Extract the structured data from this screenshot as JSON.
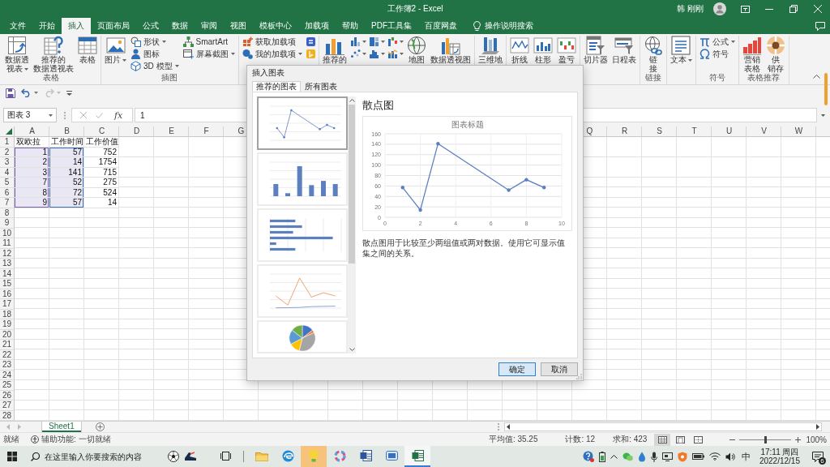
{
  "window": {
    "title": "工作簿2 - Excel",
    "user": "韩 刚刚"
  },
  "ribbon_tabs": [
    {
      "label": "文件",
      "selected": false
    },
    {
      "label": "开始",
      "selected": false
    },
    {
      "label": "插入",
      "selected": true
    },
    {
      "label": "页面布局",
      "selected": false
    },
    {
      "label": "公式",
      "selected": false
    },
    {
      "label": "数据",
      "selected": false
    },
    {
      "label": "审阅",
      "selected": false
    },
    {
      "label": "视图",
      "selected": false
    },
    {
      "label": "模板中心",
      "selected": false
    },
    {
      "label": "加载项",
      "selected": false
    },
    {
      "label": "帮助",
      "selected": false
    },
    {
      "label": "PDF工具集",
      "selected": false
    },
    {
      "label": "百度网盘",
      "selected": false
    }
  ],
  "tell_me": {
    "label": "操作说明搜索"
  },
  "ribbon_groups": [
    {
      "label": "表格",
      "items": [
        {
          "kind": "large",
          "lines": [
            "数据透",
            "视表"
          ],
          "menu": true
        },
        {
          "kind": "large",
          "lines": [
            "推荐的",
            "数据透视表"
          ],
          "menu": false
        },
        {
          "kind": "large",
          "lines": [
            "表格"
          ],
          "menu": false
        }
      ]
    },
    {
      "label": "插图",
      "items": [
        {
          "kind": "large",
          "lines": [
            "图片"
          ],
          "menu": true
        },
        {
          "kind": "stack",
          "items": [
            {
              "label": "形状",
              "menu": true
            },
            {
              "label": "图标",
              "menu": false
            },
            {
              "label": "3D 模型",
              "menu": true
            }
          ]
        },
        {
          "kind": "stack",
          "items": [
            {
              "label": "SmartArt",
              "menu": false
            },
            {
              "label": "屏幕截图",
              "menu": true
            }
          ]
        }
      ]
    },
    {
      "items": [
        {
          "kind": "stack",
          "items": [
            {
              "label": "获取加载项",
              "menu": false
            },
            {
              "label": "我的加载项",
              "menu": true
            }
          ]
        },
        {
          "kind": "icons",
          "items": [
            {
              "menu": false
            },
            {
              "menu": false
            }
          ]
        }
      ]
    },
    {
      "items": [
        {
          "kind": "large",
          "lines": [
            "推荐的"
          ],
          "menu": false
        },
        {
          "kind": "icons",
          "items": [
            {
              "menu": true
            },
            {
              "menu": true
            },
            {
              "menu": true
            },
            {
              "menu": true
            },
            {
              "menu": true
            },
            {
              "menu": true
            }
          ]
        },
        {
          "kind": "large",
          "lines": [
            "地图"
          ],
          "menu": false
        },
        {
          "kind": "large",
          "lines": [
            "数据透视图"
          ],
          "menu": false
        }
      ]
    },
    {
      "items": [
        {
          "kind": "large",
          "lines": [
            "三维地"
          ],
          "menu": false
        }
      ]
    },
    {
      "items": [
        {
          "kind": "large",
          "lines": [
            "折线"
          ],
          "menu": false
        },
        {
          "kind": "large",
          "lines": [
            "柱形"
          ],
          "menu": false
        },
        {
          "kind": "large",
          "lines": [
            "盈亏"
          ],
          "menu": false
        }
      ]
    },
    {
      "items": [
        {
          "kind": "large",
          "lines": [
            "切片器"
          ],
          "menu": false
        },
        {
          "kind": "large",
          "lines": [
            "日程表"
          ],
          "menu": false
        }
      ]
    },
    {
      "label": "链接",
      "items": [
        {
          "kind": "large",
          "lines": [
            "链",
            "接"
          ],
          "menu": false
        }
      ]
    },
    {
      "items": [
        {
          "kind": "large",
          "lines": [
            "文本"
          ],
          "menu": true
        }
      ]
    },
    {
      "label": "符号",
      "items": [
        {
          "kind": "stack",
          "items": [
            {
              "label": "公式",
              "menu": true
            },
            {
              "label": "符号",
              "menu": false
            }
          ]
        }
      ]
    },
    {
      "label": "表格推荐",
      "items": [
        {
          "kind": "large",
          "lines": [
            "营销",
            "表格"
          ],
          "menu": false
        },
        {
          "kind": "large",
          "lines": [
            "供",
            "销存"
          ],
          "menu": false
        }
      ]
    }
  ],
  "quick_access": [
    {
      "menu": false,
      "disabled": false
    },
    {
      "menu": true,
      "disabled": false
    },
    {
      "menu": true,
      "disabled": true
    },
    {
      "menu": false,
      "disabled": false
    }
  ],
  "formula_bar": {
    "name_box": "图表 3",
    "insert_function": "fx",
    "value": "1"
  },
  "sheet": {
    "columns_left": [
      "A",
      "B",
      "C",
      "D",
      "E",
      "F",
      "G"
    ],
    "columns_right": [
      "Q",
      "R",
      "S",
      "T",
      "U",
      "V",
      "W"
    ],
    "rows": [
      {
        "header": "1",
        "kind": "labels",
        "cells": [
          {
            "value": "双欧拉",
            "selected": false
          },
          {
            "value": "工作时间",
            "selected": false
          },
          {
            "value": "工作价值",
            "selected": false
          }
        ]
      },
      {
        "header": "2",
        "kind": "values",
        "cells": [
          {
            "value": "1",
            "selected": true
          },
          {
            "value": "57",
            "selected": true
          },
          {
            "value": "752",
            "selected": false
          }
        ]
      },
      {
        "header": "3",
        "kind": "values",
        "cells": [
          {
            "value": "2",
            "selected": true
          },
          {
            "value": "14",
            "selected": true
          },
          {
            "value": "1754",
            "selected": false
          }
        ]
      },
      {
        "header": "4",
        "kind": "values",
        "cells": [
          {
            "value": "3",
            "selected": true
          },
          {
            "value": "141",
            "selected": true
          },
          {
            "value": "715",
            "selected": false
          }
        ]
      },
      {
        "header": "5",
        "kind": "values",
        "cells": [
          {
            "value": "7",
            "selected": true
          },
          {
            "value": "52",
            "selected": true
          },
          {
            "value": "275",
            "selected": false
          }
        ]
      },
      {
        "header": "6",
        "kind": "values",
        "cells": [
          {
            "value": "8",
            "selected": true
          },
          {
            "value": "72",
            "selected": true
          },
          {
            "value": "524",
            "selected": false
          }
        ]
      },
      {
        "header": "7",
        "kind": "values",
        "cells": [
          {
            "value": "9",
            "selected": true
          },
          {
            "value": "57",
            "selected": true
          },
          {
            "value": "14",
            "selected": false
          }
        ]
      },
      {
        "header": "8",
        "kind": "empty"
      },
      {
        "header": "9",
        "kind": "empty"
      },
      {
        "header": "10",
        "kind": "empty"
      },
      {
        "header": "11",
        "kind": "empty"
      },
      {
        "header": "12",
        "kind": "empty"
      },
      {
        "header": "13",
        "kind": "empty"
      },
      {
        "header": "14",
        "kind": "empty"
      },
      {
        "header": "15",
        "kind": "empty"
      },
      {
        "header": "16",
        "kind": "empty"
      },
      {
        "header": "17",
        "kind": "empty"
      },
      {
        "header": "18",
        "kind": "empty"
      },
      {
        "header": "19",
        "kind": "empty"
      },
      {
        "header": "20",
        "kind": "empty"
      },
      {
        "header": "21",
        "kind": "empty"
      },
      {
        "header": "22",
        "kind": "empty"
      },
      {
        "header": "23",
        "kind": "empty"
      },
      {
        "header": "24",
        "kind": "empty"
      },
      {
        "header": "25",
        "kind": "empty"
      },
      {
        "header": "26",
        "kind": "empty"
      },
      {
        "header": "27",
        "kind": "empty"
      },
      {
        "header": "28",
        "kind": "empty"
      }
    ]
  },
  "sheet_tabs": [
    {
      "label": "Sheet1",
      "selected": true
    }
  ],
  "status_bar": {
    "mode": "就绪",
    "accessibility": "辅助功能: 一切就绪",
    "average": "平均值: 35.25",
    "count": "计数: 12",
    "sum": "求和: 423",
    "views": [
      {
        "selected": true
      },
      {
        "selected": false
      },
      {
        "selected": false
      }
    ],
    "zoom": {
      "level": 0.5,
      "reading": "100%"
    }
  },
  "taskbar": {
    "search": {
      "placeholder": "在这里输入你要搜索的内容"
    },
    "apps": [
      {
        "selected": false,
        "flashing": false
      },
      {
        "selected": false,
        "flashing": false
      },
      {
        "selected": false,
        "flashing": true
      },
      {
        "selected": false,
        "flashing": false
      },
      {
        "selected": false,
        "flashing": false
      },
      {
        "selected": false,
        "flashing": false
      },
      {
        "selected": true,
        "flashing": false
      }
    ],
    "ime": "中",
    "time": "17:11 周四",
    "date": "2022/12/15",
    "notifications": "6"
  },
  "dialog": {
    "title": "插入图表",
    "tabs": [
      {
        "label": "推荐的图表",
        "selected": true
      },
      {
        "label": "所有图表",
        "selected": false
      }
    ],
    "thumbnails": [
      {
        "kind": "scatter",
        "selected": true
      },
      {
        "kind": "column",
        "selected": false
      },
      {
        "kind": "bar",
        "selected": false
      },
      {
        "kind": "line",
        "selected": false
      },
      {
        "kind": "pie",
        "selected": false
      }
    ],
    "heading": "散点图",
    "preview": {
      "chart_data": {
        "type": "line",
        "title": "图表标题",
        "x": [
          1,
          2,
          3,
          7,
          8,
          9
        ],
        "series": [
          {
            "color": "#5b7fbf",
            "values": [
              57,
              14,
              141,
              52,
              72,
              57
            ]
          }
        ],
        "xlim": [
          0,
          10
        ],
        "ylim": [
          0,
          160
        ],
        "xticks": [
          0,
          2,
          4,
          6,
          8,
          10
        ],
        "yticks": [
          0,
          20,
          40,
          60,
          80,
          100,
          120,
          140,
          160
        ],
        "grid": true
      }
    },
    "description": "散点图用于比较至少两组值或两对数据。使用它可显示值集之间的关系。",
    "buttons": [
      {
        "label": "确定",
        "focused": true
      },
      {
        "label": "取消",
        "focused": false
      }
    ]
  }
}
